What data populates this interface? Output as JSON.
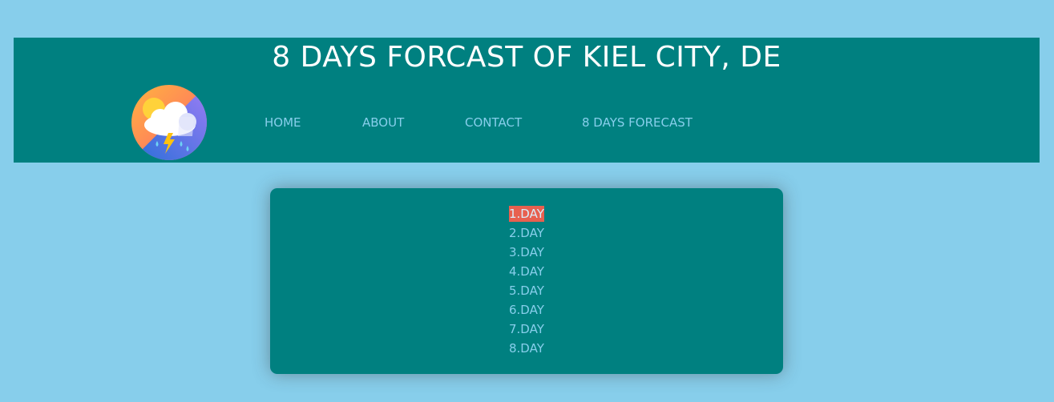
{
  "header": {
    "title": "8 DAYS FORCAST OF KIEL CITY, DE",
    "logo_icon": "weather-storm-icon",
    "nav": [
      {
        "label": "HOME"
      },
      {
        "label": "ABOUT"
      },
      {
        "label": "CONTACT"
      },
      {
        "label": "8 DAYS FORECAST"
      }
    ]
  },
  "days": {
    "items": [
      {
        "label": "1.DAY",
        "active": true
      },
      {
        "label": "2.DAY",
        "active": false
      },
      {
        "label": "3.DAY",
        "active": false
      },
      {
        "label": "4.DAY",
        "active": false
      },
      {
        "label": "5.DAY",
        "active": false
      },
      {
        "label": "6.DAY",
        "active": false
      },
      {
        "label": "7.DAY",
        "active": false
      },
      {
        "label": "8.DAY",
        "active": false
      }
    ]
  },
  "colors": {
    "page_background": "#87ceeb",
    "panel_background": "#008080",
    "title_text": "#ffffff",
    "link_text": "#87ceeb",
    "active_highlight": "#e8604f"
  }
}
